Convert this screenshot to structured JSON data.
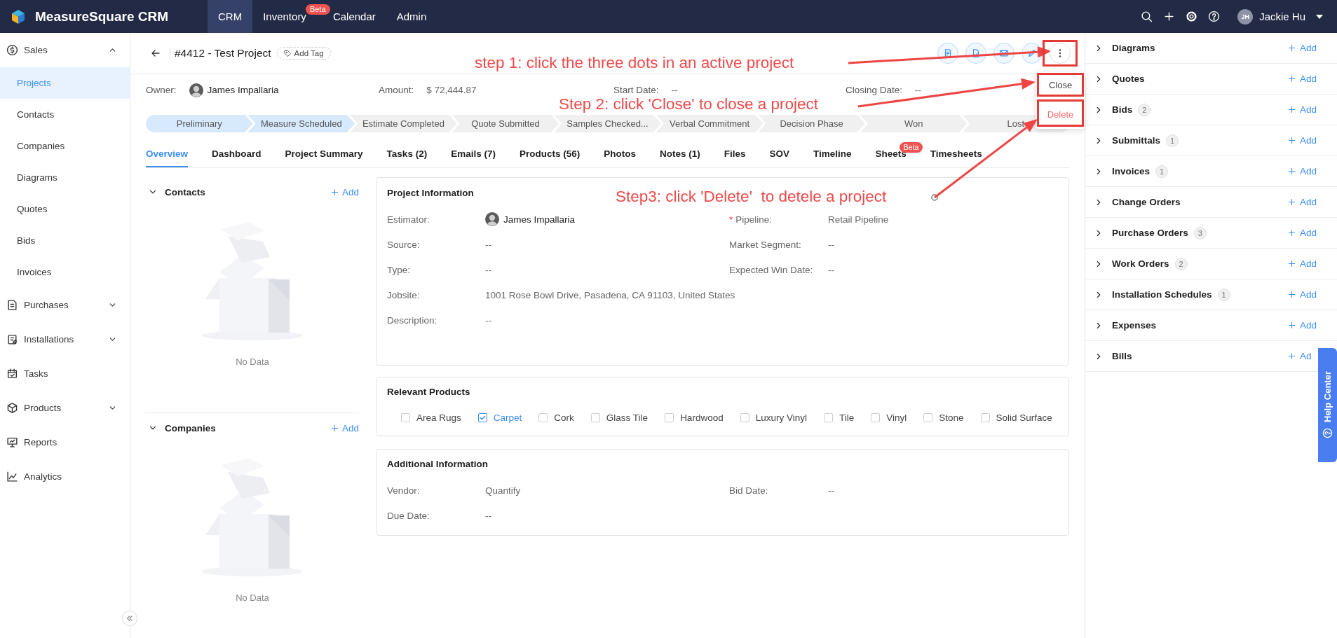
{
  "topbar": {
    "brand": "MeasureSquare CRM",
    "nav": [
      {
        "label": "CRM",
        "selected": true
      },
      {
        "label": "Inventory",
        "selected": false,
        "badge": "Beta"
      },
      {
        "label": "Calendar",
        "selected": false
      },
      {
        "label": "Admin",
        "selected": false
      }
    ],
    "user": {
      "initials": "JH",
      "name": "Jackie Hu"
    }
  },
  "sidebar": {
    "items": [
      {
        "label": "Sales",
        "kind": "group",
        "expanded": true,
        "children": [
          {
            "label": "Projects",
            "selected": true
          },
          {
            "label": "Contacts",
            "selected": false
          },
          {
            "label": "Companies",
            "selected": false
          },
          {
            "label": "Diagrams",
            "selected": false
          },
          {
            "label": "Quotes",
            "selected": false
          },
          {
            "label": "Bids",
            "selected": false
          },
          {
            "label": "Invoices",
            "selected": false
          }
        ]
      },
      {
        "label": "Purchases",
        "kind": "group",
        "expanded": false
      },
      {
        "label": "Installations",
        "kind": "group",
        "expanded": false
      },
      {
        "label": "Tasks",
        "kind": "link"
      },
      {
        "label": "Products",
        "kind": "group",
        "expanded": false
      },
      {
        "label": "Reports",
        "kind": "link"
      },
      {
        "label": "Analytics",
        "kind": "link"
      }
    ]
  },
  "project": {
    "title": "#4412 - Test Project",
    "add_tag": "Add Tag",
    "info": [
      {
        "label": "Owner:",
        "value": "James Impallaria",
        "kind": "person"
      },
      {
        "label": "Amount:",
        "value": "$ 72,444.87",
        "kind": "text"
      },
      {
        "label": "Start Date:",
        "value": "--",
        "kind": "text"
      },
      {
        "label": "Closing Date:",
        "value": "--",
        "kind": "text"
      }
    ]
  },
  "more_menu": {
    "items": [
      {
        "label": "Close",
        "kind": "normal"
      },
      {
        "label": "Delete",
        "kind": "danger"
      }
    ]
  },
  "stages": [
    {
      "label": "Preliminary",
      "reached": true
    },
    {
      "label": "Measure Scheduled",
      "reached": true
    },
    {
      "label": "Estimate Completed",
      "reached": false
    },
    {
      "label": "Quote Submitted",
      "reached": false
    },
    {
      "label": "Samples Checked...",
      "reached": false
    },
    {
      "label": "Verbal Commitment",
      "reached": false
    },
    {
      "label": "Decision Phase",
      "reached": false
    },
    {
      "label": "Won",
      "reached": false
    },
    {
      "label": "Lost",
      "reached": false
    }
  ],
  "tabs": [
    {
      "label": "Overview",
      "selected": true
    },
    {
      "label": "Dashboard",
      "selected": false
    },
    {
      "label": "Project Summary",
      "selected": false
    },
    {
      "label": "Tasks (2)",
      "selected": false
    },
    {
      "label": "Emails (7)",
      "selected": false
    },
    {
      "label": "Products (56)",
      "selected": false
    },
    {
      "label": "Photos",
      "selected": false
    },
    {
      "label": "Notes (1)",
      "selected": false
    },
    {
      "label": "Files",
      "selected": false
    },
    {
      "label": "SOV",
      "selected": false
    },
    {
      "label": "Timeline",
      "selected": false
    },
    {
      "label": "Sheets",
      "selected": false,
      "badge": "Beta"
    },
    {
      "label": "Timesheets",
      "selected": false
    }
  ],
  "contacts": {
    "title": "Contacts",
    "add": "Add",
    "empty": "No Data",
    "expanded": true
  },
  "companies": {
    "title": "Companies",
    "add": "Add",
    "empty": "No Data",
    "expanded": true
  },
  "project_information": {
    "title": "Project Information",
    "left": [
      {
        "label": "Estimator:",
        "value": "James Impallaria",
        "kind": "person"
      },
      {
        "label": "Source:",
        "value": "--",
        "kind": "text"
      },
      {
        "label": "Type:",
        "value": "--",
        "kind": "text"
      },
      {
        "label": "Jobsite:",
        "value": "1001 Rose Bowl Drive, Pasadena, CA 91103, United States",
        "kind": "editable"
      },
      {
        "label": "Description:",
        "value": "--",
        "kind": "text"
      }
    ],
    "right": [
      {
        "label": "Pipeline:",
        "value": "Retail Pipeline",
        "kind": "text",
        "required_mark": "*"
      },
      {
        "label": "Market Segment:",
        "value": "--",
        "kind": "text"
      },
      {
        "label": "Expected Win Date:",
        "value": "--",
        "kind": "text"
      }
    ]
  },
  "relevant_products": {
    "title": "Relevant Products",
    "items": [
      {
        "label": "Area Rugs",
        "checked": false
      },
      {
        "label": "Carpet",
        "checked": true
      },
      {
        "label": "Cork",
        "checked": false
      },
      {
        "label": "Glass Tile",
        "checked": false
      },
      {
        "label": "Hardwood",
        "checked": false
      },
      {
        "label": "Luxury Vinyl",
        "checked": false
      },
      {
        "label": "Tile",
        "checked": false
      },
      {
        "label": "Vinyl",
        "checked": false
      },
      {
        "label": "Stone",
        "checked": false
      },
      {
        "label": "Solid Surface",
        "checked": false
      }
    ]
  },
  "additional_information": {
    "title": "Additional Information",
    "left": [
      {
        "label": "Vendor:",
        "value": "Quantify",
        "kind": "text"
      },
      {
        "label": "Due Date:",
        "value": "--",
        "kind": "text"
      }
    ],
    "right": [
      {
        "label": "Bid Date:",
        "value": "--",
        "kind": "text"
      }
    ]
  },
  "right_panel": {
    "items": [
      {
        "label": "Diagrams",
        "expanded": false,
        "add": "Add"
      },
      {
        "label": "Quotes",
        "expanded": false,
        "add": "Add"
      },
      {
        "label": "Bids",
        "count": "2",
        "expanded": false,
        "add": "Add"
      },
      {
        "label": "Submittals",
        "count": "1",
        "expanded": false,
        "add": "Add"
      },
      {
        "label": "Invoices",
        "count": "1",
        "expanded": false,
        "add": "Add"
      },
      {
        "label": "Change Orders",
        "expanded": false,
        "add": "Add"
      },
      {
        "label": "Purchase Orders",
        "count": "3",
        "expanded": false,
        "add": "Add"
      },
      {
        "label": "Work Orders",
        "count": "2",
        "expanded": false,
        "add": "Add"
      },
      {
        "label": "Installation Schedules",
        "count": "1",
        "expanded": false,
        "add": "Add"
      },
      {
        "label": "Expenses",
        "expanded": false,
        "add": "Add"
      },
      {
        "label": "Bills",
        "expanded": false,
        "add": "Ad"
      }
    ]
  },
  "help_center": "Help Center",
  "annotations": [
    {
      "text": "step 1: click the three dots in an active project"
    },
    {
      "text": "Step 2: click 'Close' to close a project"
    },
    {
      "text": "Step3: click 'Delete'  to detele a project"
    }
  ]
}
